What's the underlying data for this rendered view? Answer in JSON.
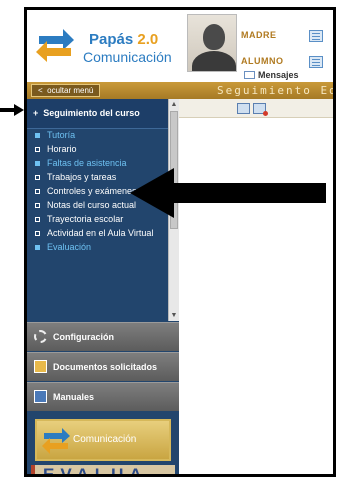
{
  "header": {
    "logo_title": "Papás",
    "logo_version": "2.0",
    "logo_subtitle": "Comunicación",
    "role_parent": "MADRE",
    "role_student": "ALUMNO",
    "messages_label": "Mensajes"
  },
  "bar": {
    "hide_menu_label": "ocultar menú",
    "section_title": "Seguimiento Educ"
  },
  "sidebar": {
    "section_label": "Seguimiento del curso",
    "items": [
      {
        "label": "Tutoría"
      },
      {
        "label": "Horario"
      },
      {
        "label": "Faltas de asistencia"
      },
      {
        "label": "Trabajos y tareas"
      },
      {
        "label": "Controles y exámenes"
      },
      {
        "label": "Notas del curso actual"
      },
      {
        "label": "Trayectoria escolar"
      },
      {
        "label": "Actividad en el Aula Virtual"
      },
      {
        "label": "Evaluación"
      }
    ],
    "config_label": "Configuración",
    "docs_label": "Documentos solicitados",
    "manuals_label": "Manuales",
    "promo_label": "Comunicación",
    "evalua_label": "EVALUA"
  },
  "colors": {
    "sidebar_bg": "#22456d",
    "link": "#6ec1f2",
    "gold_bar": "#b88a2f",
    "brand_blue": "#2c7cc1"
  },
  "icons": [
    "arrows-logo-icon",
    "avatar-icon",
    "mail-icon",
    "gear-icon",
    "documents-icon",
    "book-icon",
    "arrow-pointer-icon"
  ]
}
